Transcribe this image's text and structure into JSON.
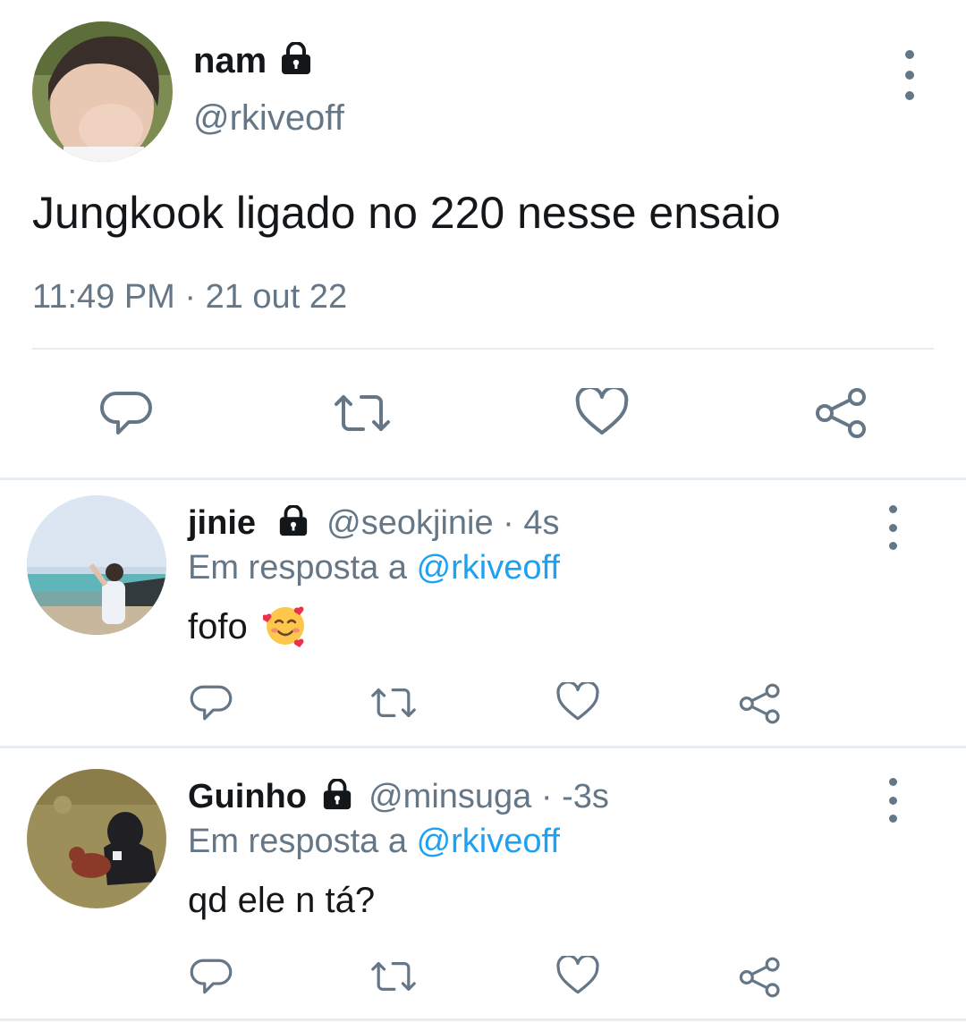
{
  "main_tweet": {
    "display_name": "nam",
    "handle": "@rkiveoff",
    "text": "Jungkook ligado no 220 nesse ensaio",
    "timestamp": "11:49 PM · 21 out 22",
    "protected": true
  },
  "replies": [
    {
      "display_name": "jinie",
      "handle": "@seokjinie",
      "age": "· 4s",
      "reply_prefix": "Em resposta a",
      "reply_to": "@rkiveoff",
      "text": "fofo",
      "emoji": "smiling-face-with-hearts",
      "protected": true
    },
    {
      "display_name": "Guinho",
      "handle": "@minsuga",
      "age": "· -3s",
      "reply_prefix": "Em resposta a",
      "reply_to": "@rkiveoff",
      "text": "qd ele n tá?",
      "protected": true
    }
  ],
  "actions": [
    "reply-icon",
    "retweet-icon",
    "like-icon",
    "share-icon"
  ],
  "colors": {
    "text": "#14171a",
    "muted": "#657786",
    "link": "#1da1f2",
    "divider": "#e6ecf0"
  }
}
